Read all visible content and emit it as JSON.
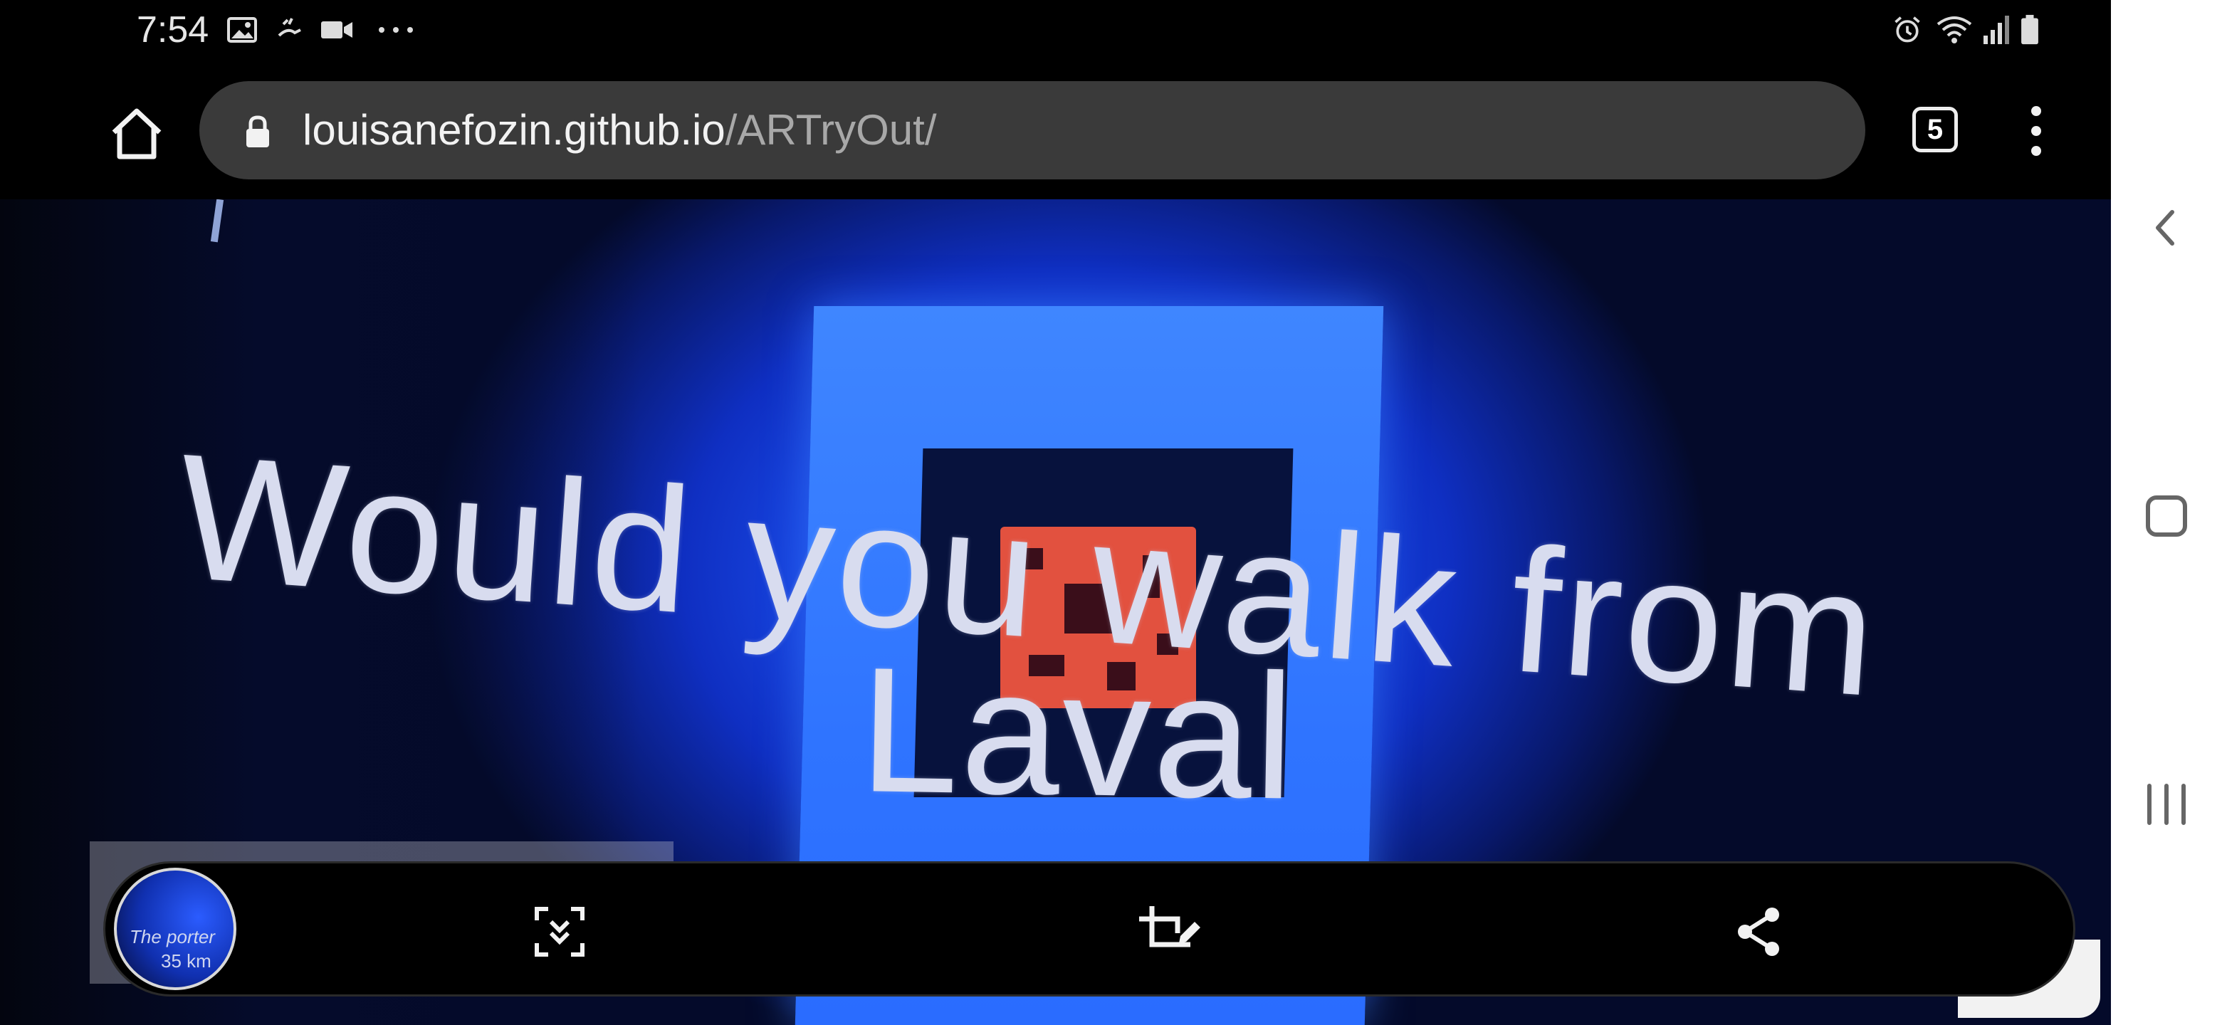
{
  "status_bar": {
    "time": "7:54",
    "left_icons": [
      "gallery-icon",
      "hand-wave-icon",
      "video-camera-icon",
      "more-dots-icon"
    ],
    "right_icons": [
      "alarm-icon",
      "wifi-icon",
      "signal-icon",
      "battery-icon"
    ]
  },
  "browser": {
    "url_host": "louisanefozin.github.io",
    "url_path": "/ARTryOut/",
    "tab_count": "5"
  },
  "ar_overlay": {
    "line1": "Would you walk from",
    "line2": "Laval"
  },
  "screenshot_toolbar": {
    "thumbnail_text_1": "The porter",
    "thumbnail_text_2": "35 km",
    "actions": [
      "scroll-capture",
      "crop-edit",
      "share"
    ]
  },
  "colors": {
    "scene_blue": "#1a4be8",
    "marker_red": "#e2513f",
    "url_bar": "#3a3a3a"
  }
}
